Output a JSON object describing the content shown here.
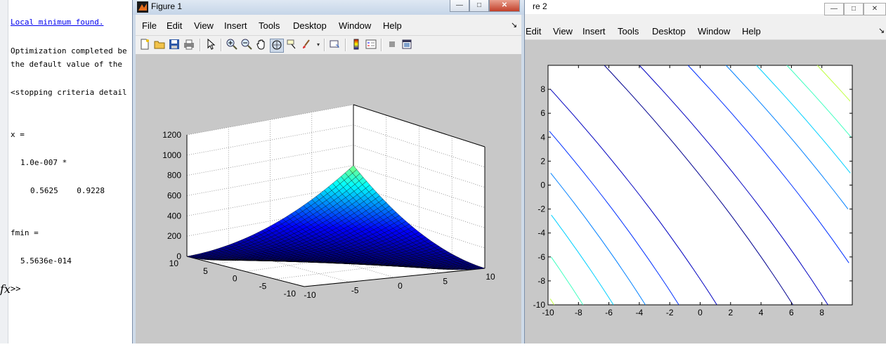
{
  "command_window": {
    "lines": [
      "Local minimum found.",
      "Optimization completed be",
      "the default value of the",
      "<stopping criteria detail",
      "x =",
      "1.0e-007 *",
      "0.5625    0.9228",
      "fmin =",
      "5.5636e-014"
    ],
    "fx_symbol": "fx",
    "prompt": ">>"
  },
  "figure1": {
    "title": "Figure 1",
    "menu": [
      "File",
      "Edit",
      "View",
      "Insert",
      "Tools",
      "Desktop",
      "Window",
      "Help"
    ],
    "dock_arrow": "↘",
    "toolbar_icons": [
      "new-figure-icon",
      "open-icon",
      "save-icon",
      "print-icon",
      "pointer-icon",
      "zoom-in-icon",
      "zoom-out-icon",
      "pan-icon",
      "rotate-3d-icon",
      "data-cursor-icon",
      "brush-icon",
      "link-plot-icon",
      "colorbar-icon",
      "legend-icon",
      "hide-plot-tools-icon",
      "show-plot-tools-icon"
    ],
    "window_buttons": {
      "minimize": "—",
      "maximize": "□",
      "close": "✕"
    }
  },
  "figure2": {
    "title_fragment": "re 2",
    "menu": [
      "Edit",
      "View",
      "Insert",
      "Tools",
      "Desktop",
      "Window",
      "Help"
    ],
    "dock_arrow": "↘",
    "window_buttons": {
      "minimize": "—",
      "maximize": "□",
      "close": "✕"
    }
  },
  "chart_data": [
    {
      "type": "surface",
      "title": "",
      "xlabel": "",
      "ylabel": "",
      "zlabel": "",
      "x_range": [
        -10,
        10
      ],
      "y_range": [
        -10,
        10
      ],
      "z_range": [
        0,
        1200
      ],
      "z_ticks": [
        0,
        200,
        400,
        600,
        800,
        1000,
        1200
      ],
      "x_ticks": [
        -5,
        0,
        5,
        10
      ],
      "y_ticks": [
        -10,
        -5,
        0,
        5,
        10
      ],
      "colormap": "jet",
      "grid": true
    },
    {
      "type": "contour",
      "title": "",
      "xlabel": "",
      "ylabel": "",
      "xlim": [
        -10,
        10
      ],
      "ylim": [
        -10,
        10
      ],
      "x_ticks": [
        -10,
        -8,
        -6,
        -4,
        -2,
        0,
        2,
        4,
        6,
        8
      ],
      "y_ticks": [
        -10,
        -8,
        -6,
        -4,
        -2,
        0,
        2,
        4,
        6,
        8
      ],
      "colormap": "jet",
      "contour_levels": [
        0.3,
        0.8,
        1.3,
        1.8,
        2.3,
        2.8,
        3.3,
        3.8,
        4.3
      ]
    }
  ]
}
